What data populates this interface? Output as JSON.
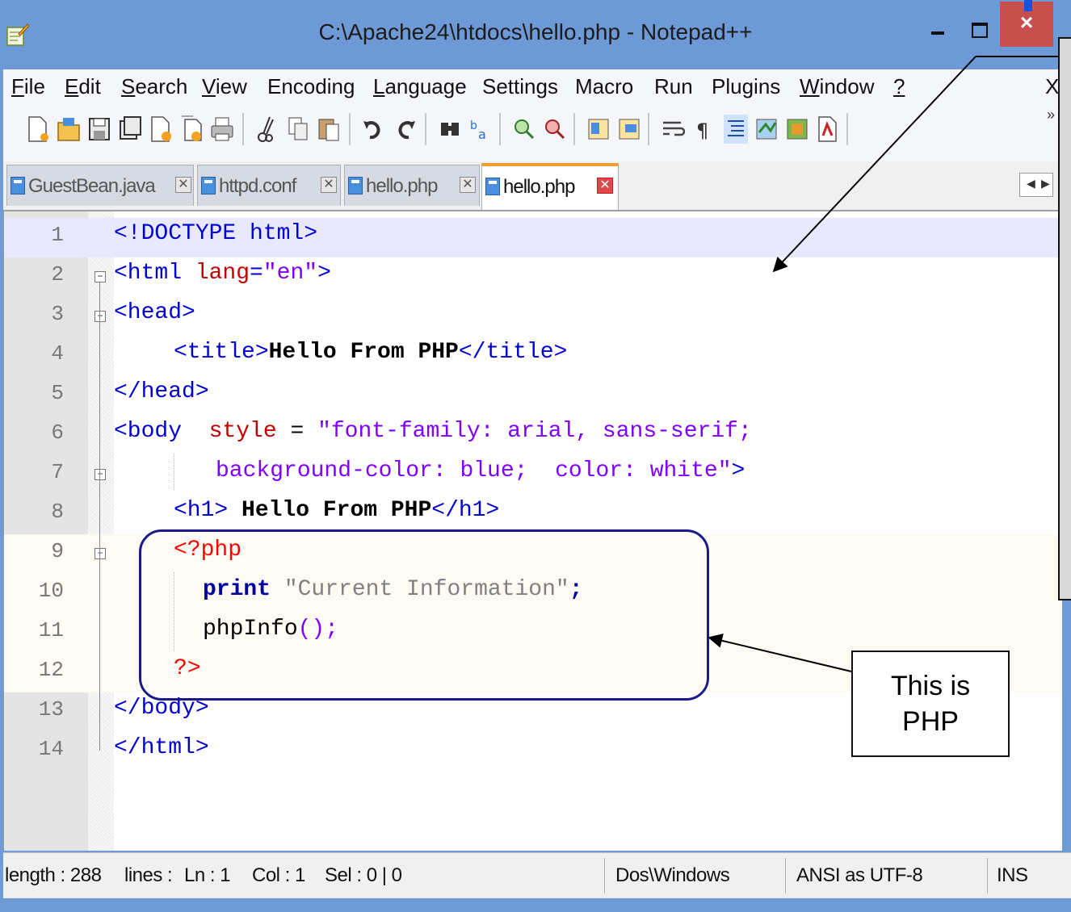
{
  "window": {
    "title": "C:\\Apache24\\htdocs\\hello.php - Notepad++",
    "close_symbol": "×"
  },
  "menu": [
    {
      "label": "File",
      "u": "F",
      "rest": "ile"
    },
    {
      "label": "Edit",
      "u": "E",
      "rest": "dit"
    },
    {
      "label": "Search",
      "u": "S",
      "rest": "earch"
    },
    {
      "label": "View",
      "u": "V",
      "rest": "iew"
    },
    {
      "label": "Encoding",
      "u": "",
      "rest": "Encoding"
    },
    {
      "label": "Language",
      "u": "L",
      "rest": "anguage"
    },
    {
      "label": "Settings",
      "u": "",
      "rest": "Settings"
    },
    {
      "label": "Macro",
      "u": "",
      "rest": "Macro"
    },
    {
      "label": "Run",
      "u": "",
      "rest": "Run"
    },
    {
      "label": "Plugins",
      "u": "",
      "rest": "Plugins"
    },
    {
      "label": "Window",
      "u": "W",
      "rest": "indow"
    },
    {
      "label": "?",
      "u": "?",
      "rest": ""
    }
  ],
  "menu_close": "X",
  "tabs": [
    {
      "label": "GuestBean.java",
      "active": false
    },
    {
      "label": "httpd.conf",
      "active": false
    },
    {
      "label": "hello.php",
      "active": false
    },
    {
      "label": "hello.php",
      "active": true
    }
  ],
  "code_lines": [
    {
      "n": "1"
    },
    {
      "n": "2"
    },
    {
      "n": "3"
    },
    {
      "n": "4"
    },
    {
      "n": "5"
    },
    {
      "n": "6"
    },
    {
      "n": "7"
    },
    {
      "n": "8"
    },
    {
      "n": "9"
    },
    {
      "n": "10"
    },
    {
      "n": "11"
    },
    {
      "n": "12"
    },
    {
      "n": "13"
    },
    {
      "n": "14"
    }
  ],
  "code": {
    "l1": "<!DOCTYPE html>",
    "l2_tag": "<html ",
    "l2_attr": "lang",
    "l2_eq": "=",
    "l2_str": "\"en\"",
    "l2_end": ">",
    "l3": "<head>",
    "l4_open": "<title>",
    "l4_text": "Hello From PHP",
    "l4_close": "</title>",
    "l5": "</head>",
    "l6_tag": "<body",
    "l6_attr": "style",
    "l6_eq": " = ",
    "l6_str": "\"font-family: arial, sans-serif;",
    "l7_str": "background-color: blue;  color: white\"",
    "l7_end": ">",
    "l8_open": "<h1>",
    "l8_text": " Hello From PHP",
    "l8_close": "</h1>",
    "l9": "<?php",
    "l10_kw": "print",
    "l10_str": "\"Current Information\"",
    "l10_end": ";",
    "l11_fn": "phpInfo",
    "l11_paren": "();",
    "l12": "?>",
    "l13": "</body>",
    "l14": "</html>"
  },
  "status": {
    "length": "length : 288",
    "lines": "lines :",
    "ln": "Ln : 1",
    "col": "Col : 1",
    "sel": "Sel : 0 | 0",
    "eol": "Dos\\Windows",
    "encoding": "ANSI as UTF-8",
    "mode": "INS"
  },
  "annotation": {
    "line1": "This is",
    "line2": "PHP"
  },
  "colors": {
    "titlebar": "#6d9ad6",
    "close_button": "#c7504f",
    "current_line": "#e8e8ff",
    "tag": "#0000d0",
    "attribute": "#c00000",
    "string": "#8000ff",
    "php_delimiter": "#ff0000"
  }
}
